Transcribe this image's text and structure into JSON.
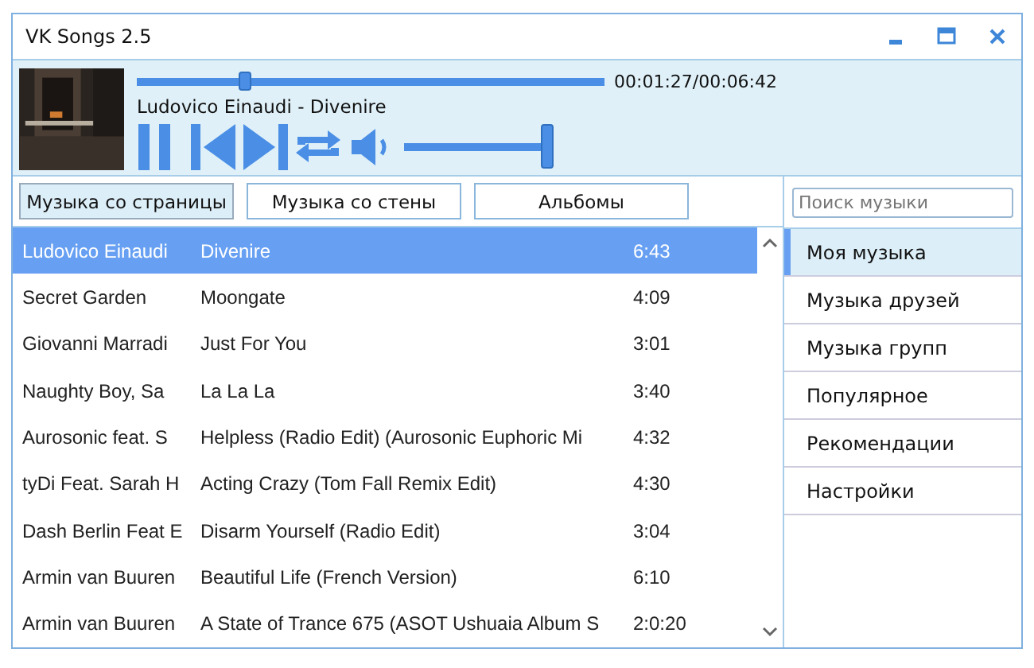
{
  "window": {
    "title": "VK Songs 2.5"
  },
  "player": {
    "time": "00:01:27/00:06:42",
    "track": "Ludovico Einaudi - Divenire",
    "progress": {
      "level": 0.23
    },
    "volume": {
      "level": 1
    }
  },
  "tabs": [
    {
      "label": "Музыка со страницы",
      "selected": true
    },
    {
      "label": "Музыка со стены",
      "selected": false
    },
    {
      "label": "Альбомы",
      "selected": false
    }
  ],
  "search": {
    "placeholder": "Поиск музыки"
  },
  "songs": [
    {
      "artist": "Ludovico Einaudi",
      "title": "Divenire",
      "duration": "6:43",
      "selected": true
    },
    {
      "artist": "Secret Garden",
      "title": "Moongate",
      "duration": "4:09",
      "selected": false
    },
    {
      "artist": "Giovanni Marradi",
      "title": "Just For You",
      "duration": "3:01",
      "selected": false
    },
    {
      "artist": "Naughty Boy, Sa",
      "title": "La La La",
      "duration": "3:40",
      "selected": false
    },
    {
      "artist": "Aurosonic feat. S",
      "title": " Helpless  (Radio Edit) (Aurosonic Euphoric Mi",
      "duration": "4:32",
      "selected": false
    },
    {
      "artist": "tyDi Feat. Sarah H",
      "title": "Acting Crazy (Tom Fall Remix Edit)",
      "duration": "4:30",
      "selected": false
    },
    {
      "artist": "Dash Berlin Feat E",
      "title": "Disarm Yourself (Radio Edit)",
      "duration": "3:04",
      "selected": false
    },
    {
      "artist": "Armin van Buuren",
      "title": "Beautiful Life (French Version)",
      "duration": "6:10",
      "selected": false
    },
    {
      "artist": "Armin van Buuren",
      "title": "A State of Trance 675 (ASOT Ushuaia Album S",
      "duration": "2:0:20",
      "selected": false
    }
  ],
  "nav": [
    {
      "label": "Моя музыка",
      "selected": true
    },
    {
      "label": "Музыка друзей",
      "selected": false
    },
    {
      "label": "Музыка групп",
      "selected": false
    },
    {
      "label": "Популярное",
      "selected": false
    },
    {
      "label": "Рекомендации",
      "selected": false
    },
    {
      "label": "Настройки",
      "selected": false
    }
  ]
}
